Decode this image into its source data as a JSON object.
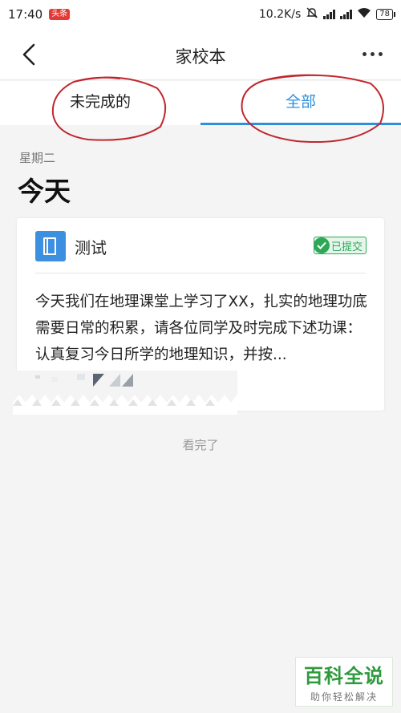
{
  "status_bar": {
    "time": "17:40",
    "app_badge": "头条",
    "network_speed": "10.2K/s",
    "battery": "78"
  },
  "nav": {
    "title": "家校本"
  },
  "tabs": [
    {
      "label": "未完成的",
      "active": false
    },
    {
      "label": "全部",
      "active": true
    }
  ],
  "day": {
    "weekday": "星期二",
    "label": "今天"
  },
  "card": {
    "title": "测试",
    "status": "已提交",
    "body": "今天我们在地理课堂上学习了XX，扎实的地理功底需要日常的积累，请各位同学及时完成下述功课：认真复习今日所学的地理知识，并按..."
  },
  "footer_text": "看完了",
  "watermark": {
    "main": "百科全说",
    "sub": "助你轻松解决"
  },
  "colors": {
    "accent": "#2f8fdc",
    "success": "#2ea857",
    "annotation": "#c0272d"
  }
}
